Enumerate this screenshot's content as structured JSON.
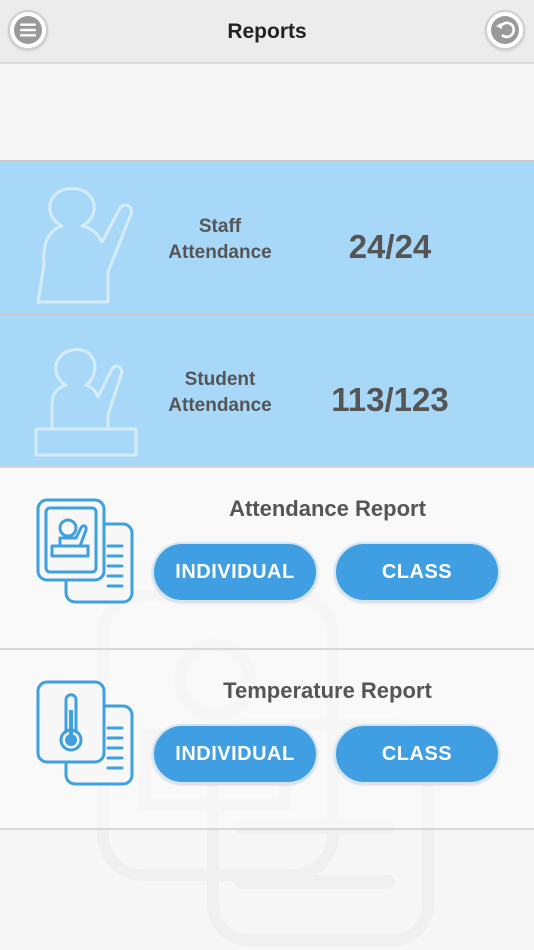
{
  "header": {
    "title": "Reports",
    "menu_icon": "hamburger-menu-icon",
    "back_icon": "undo-back-icon"
  },
  "stats": [
    {
      "label_line1": "Staff",
      "label_line2": "Attendance",
      "value": "24/24"
    },
    {
      "label_line1": "Student",
      "label_line2": "Attendance",
      "value": "113/123"
    }
  ],
  "reports": [
    {
      "title": "Attendance Report",
      "individual": "INDIVIDUAL",
      "class": "CLASS"
    },
    {
      "title": "Temperature Report",
      "individual": "INDIVIDUAL",
      "class": "CLASS"
    }
  ],
  "colors": {
    "accent": "#3f9fe2",
    "tile_blue": "#a8d8f8",
    "icon_blue": "#3fa0e0"
  }
}
